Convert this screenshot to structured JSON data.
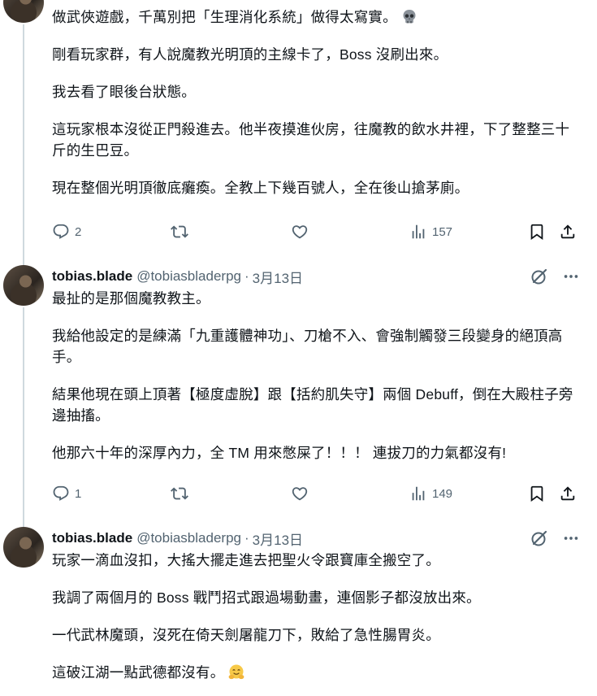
{
  "tweets": [
    {
      "paragraphs": [
        "做武俠遊戲，千萬別把「生理消化系統」做得太寫實。",
        "剛看玩家群，有人說魔教光明頂的主線卡了，Boss 沒刷出來。",
        "我去看了眼後台狀態。",
        "這玩家根本沒從正門殺進去。他半夜摸進伙房，往魔教的飲水井裡，下了整整三十斤的生巴豆。",
        "現在整個光明頂徹底癱瘓。全教上下幾百號人，全在後山搶茅廁。"
      ],
      "trailing_emoji": "skull-emoji",
      "actions": {
        "replies": "2",
        "views": "157"
      }
    },
    {
      "author": {
        "name": "tobias.blade",
        "handle": "@tobiasbladerpg",
        "sep": "·",
        "date": "3月13日"
      },
      "paragraphs": [
        "最扯的是那個魔教教主。",
        "我給他設定的是練滿「九重護體神功」、刀槍不入、會強制觸發三段變身的絕頂高手。",
        "結果他現在頭上頂著【極度虛脫】跟【括約肌失守】兩個 Debuff，倒在大殿柱子旁邊抽搐。",
        "他那六十年的深厚內力，全 TM 用來憋屎了！！！ 連拔刀的力氣都沒有!"
      ],
      "actions": {
        "replies": "1",
        "views": "149"
      }
    },
    {
      "author": {
        "name": "tobias.blade",
        "handle": "@tobiasbladerpg",
        "sep": "·",
        "date": "3月13日"
      },
      "paragraphs": [
        "玩家一滴血沒扣，大搖大擺走進去把聖火令跟寶庫全搬空了。",
        "我調了兩個月的 Boss 戰鬥招式跟過場動畫，連個影子都沒放出來。",
        "一代武林魔頭，沒死在倚天劍屠龍刀下，敗給了急性腸胃炎。",
        "這破江湖一點武德都沒有。"
      ],
      "trailing_emoji": "hugging-face-emoji"
    }
  ],
  "colors": {
    "text": "#0f1419",
    "secondary": "#536471",
    "thread_line": "#cfd9de"
  }
}
